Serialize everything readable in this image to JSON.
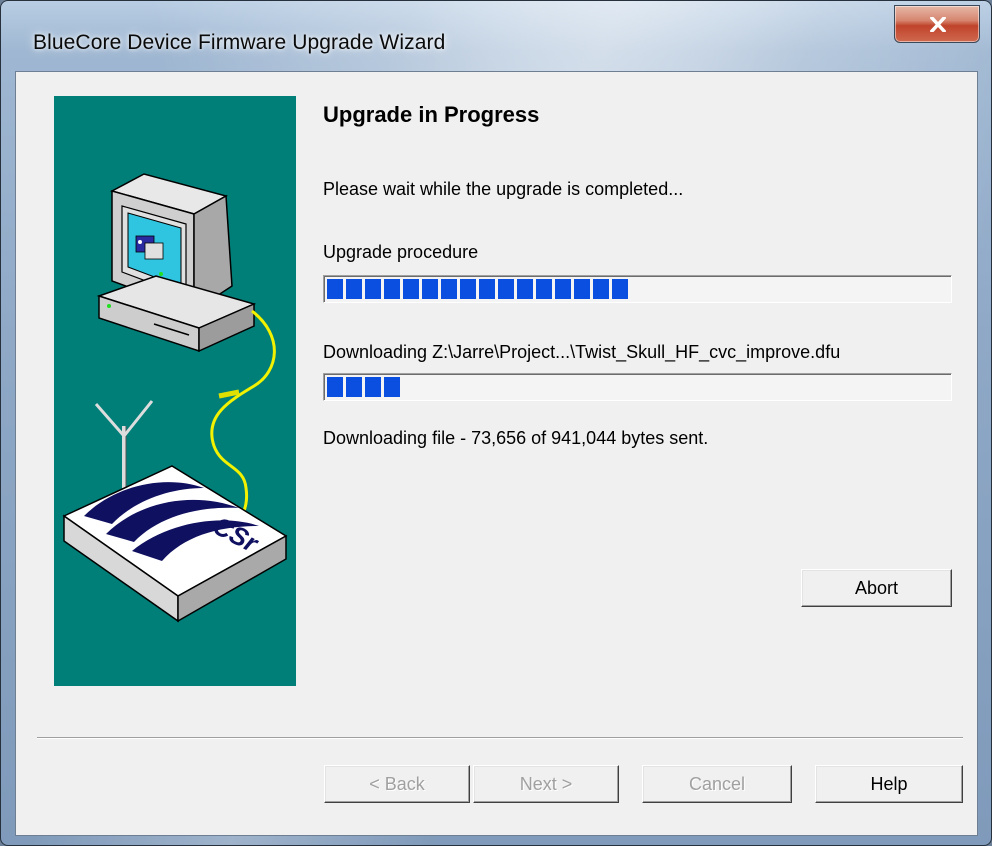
{
  "window": {
    "title": "BlueCore Device Firmware Upgrade Wizard",
    "close_label": "close"
  },
  "page": {
    "heading": "Upgrade in Progress",
    "message": "Please wait while the upgrade is completed...",
    "procedure_label": "Upgrade procedure",
    "procedure_progress": 0.48,
    "file_label": "Downloading Z:\\Jarre\\Project...\\Twist_Skull_HF_cvc_improve.dfu",
    "file_progress": 0.13,
    "status": "Downloading file - 73,656 of 941,044 bytes sent."
  },
  "buttons": {
    "abort": "Abort",
    "back": "< Back",
    "next": "Next >",
    "cancel": "Cancel",
    "help": "Help"
  },
  "illustration": {
    "logo_text": "CSr",
    "background_color": "#007f78",
    "accent_color": "#0a4fe0"
  }
}
